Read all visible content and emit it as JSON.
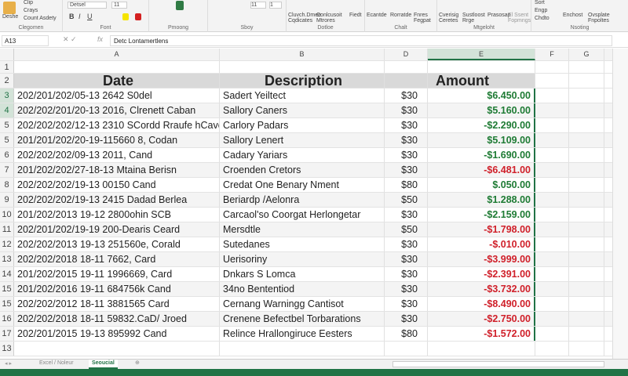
{
  "ribbon": {
    "clipboard": {
      "paste": "Deshe",
      "clip": "Clip",
      "copy": "Crays",
      "format_painter": "Count Asdety",
      "label": "Clegomen"
    },
    "font": {
      "name": "Detsel",
      "size": "11",
      "label": "Font",
      "bold": "B",
      "italic": "I",
      "underline": "U"
    },
    "alignment": {
      "label": "Pmoong"
    },
    "number": {
      "format": "11",
      "decimals": "1",
      "label": "Sboy"
    },
    "styles": {
      "cond": "Conlcusoit Mtrores",
      "field": "Fiedt",
      "label": "Dotloe",
      "editing": "Cluvch.Dmee Cqdicates"
    },
    "chart": {
      "item1": "Ecantde",
      "item2": "Rorratde",
      "item3": "Fnres Fegpat",
      "label": "Chalt"
    },
    "migeloht": {
      "item1": "Cverisig Ceretes",
      "item2": "Sustloost Rrge",
      "item3": "Prasosap",
      "item4": "El Ssent Fopmngs",
      "label": "Mtgeloht"
    },
    "nsoting": {
      "item1": "Sort",
      "item2": "Engp",
      "item3": "Chdto",
      "item4": "Enchost",
      "item5": "Ovsplate Fnpoltes",
      "label": "Nsoting"
    }
  },
  "formula_bar": {
    "name_box": "A13",
    "fx": "fx",
    "formula": "Detc Lontamertlens"
  },
  "columns": [
    "A",
    "B",
    "D",
    "E",
    "F",
    "G"
  ],
  "headers": {
    "row": "2",
    "date": "Date",
    "description": "Description",
    "amount": "Amount"
  },
  "colors": {
    "positive": "#1e7b34",
    "negative": "#d0202a",
    "excel_green": "#217346"
  },
  "rows": [
    {
      "n": "3",
      "date": "202/201/202/05-13 2642 S0del",
      "desc": "Sadert Yeiltect",
      "d": "$30",
      "amount": "$6.450.00",
      "sign": "pos"
    },
    {
      "n": "4",
      "date": "202/202/201/20-13 2016, Clrenett Caban",
      "desc": "Sallory Caners",
      "d": "$30",
      "amount": "$5.160.00",
      "sign": "pos"
    },
    {
      "n": "5",
      "date": "202/202/202/12-13 2310 SCordd Rraufe hCaver",
      "desc": "Carlory Padars",
      "d": "$30",
      "amount": "-$2.290.00",
      "sign": "pos"
    },
    {
      "n": "5",
      "date": "201/201/202/20-19-115660 8, Codan",
      "desc": "Sallory Lenert",
      "d": "$30",
      "amount": "$5.109.00",
      "sign": "pos"
    },
    {
      "n": "6",
      "date": "202/202/202/09-13 2011, Cand",
      "desc": "Cadary Yariars",
      "d": "$30",
      "amount": "-$1.690.00",
      "sign": "pos"
    },
    {
      "n": "7",
      "date": "201/202/202/27-18-13 Mtaina Berisn",
      "desc": "Croenden Cretors",
      "d": "$30",
      "amount": "-$6.481.00",
      "sign": "neg"
    },
    {
      "n": "8",
      "date": "202/202/202/19-13 00150 Cand",
      "desc": "Credat One Benary Nment",
      "d": "$80",
      "amount": "$.050.00",
      "sign": "pos"
    },
    {
      "n": "9",
      "date": "202/202/202/19-13 2415 Dadad Berlea",
      "desc": "Beriardp /Aelonra",
      "d": "$50",
      "amount": "$1.288.00",
      "sign": "pos"
    },
    {
      "n": "10",
      "date": "201/202/2013 19-12 2800ohin SCB",
      "desc": "Carcaol'so Coorgat Herlongetar",
      "d": "$30",
      "amount": "-$2.159.00",
      "sign": "pos"
    },
    {
      "n": "11",
      "date": "202/201/202/19-19 200-Dearis Ceard",
      "desc": "Mersdtle",
      "d": "$50",
      "amount": "-$1.798.00",
      "sign": "neg"
    },
    {
      "n": "12",
      "date": "202/202/2013 19-13 251560e, Corald",
      "desc": "Sutedanes",
      "d": "$30",
      "amount": "-$.010.00",
      "sign": "neg"
    },
    {
      "n": "13",
      "date": "202/202/2018 18-11 7662, Card",
      "desc": "Uerisoriny",
      "d": "$30",
      "amount": "-$3.999.00",
      "sign": "neg"
    },
    {
      "n": "14",
      "date": "201/202/2015 19-11 1996669, Card",
      "desc": "Dnkars S Lomca",
      "d": "$30",
      "amount": "-$2.391.00",
      "sign": "neg"
    },
    {
      "n": "15",
      "date": "201/202/2016 19-11 684756k Cand",
      "desc": "34no Bententiod",
      "d": "$30",
      "amount": "-$3.732.00",
      "sign": "neg"
    },
    {
      "n": "15",
      "date": "202/202/2012 18-11 3881565 Card",
      "desc": "Cernang Warningg Cantisot",
      "d": "$30",
      "amount": "-$8.490.00",
      "sign": "neg"
    },
    {
      "n": "16",
      "date": "202/202/2018 18-11 59832.CaD/ Jroed",
      "desc": "Crenene Befectbel Torbarations",
      "d": "$30",
      "amount": "-$2.750.00",
      "sign": "neg"
    },
    {
      "n": "17",
      "date": "202/201/2015 19-13 895992 Cand",
      "desc": "Relince Hrallongiruce Eesters",
      "d": "$80",
      "amount": "-$1.572.00",
      "sign": "neg"
    }
  ],
  "extra_rows": [
    "1",
    "13"
  ],
  "sheet_tabs": [
    {
      "label": "Excel / Noleur",
      "active": false
    },
    {
      "label": "Seoucial",
      "active": true
    }
  ]
}
